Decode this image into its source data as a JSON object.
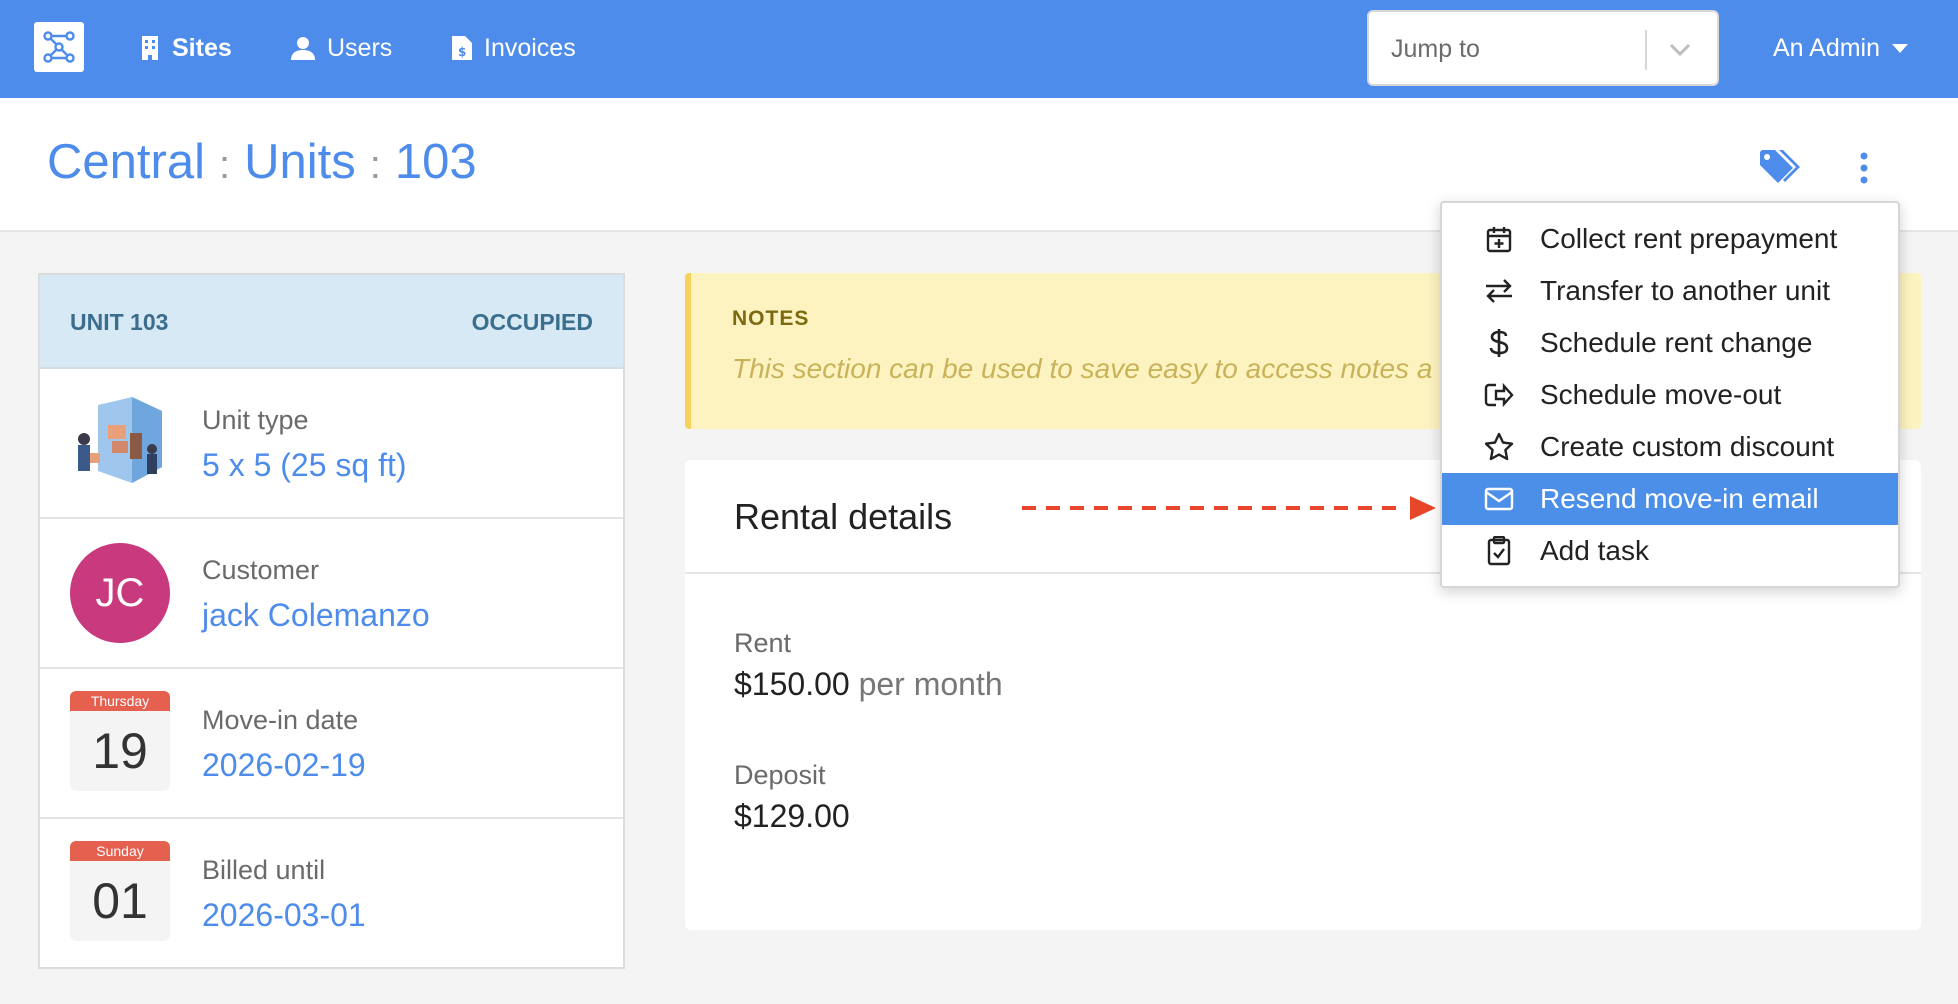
{
  "navbar": {
    "links": [
      {
        "label": "Sites",
        "icon": "building-icon",
        "active": true
      },
      {
        "label": "Users",
        "icon": "user-icon",
        "active": false
      },
      {
        "label": "Invoices",
        "icon": "invoice-icon",
        "active": false
      }
    ],
    "jump_to": {
      "placeholder": "Jump to"
    },
    "admin_label": "An Admin"
  },
  "breadcrumb": [
    "Central",
    "Units",
    "103"
  ],
  "unit_panel": {
    "header_left": "UNIT 103",
    "header_right": "OCCUPIED",
    "unit_type": {
      "label": "Unit type",
      "value": "5 x 5 (25 sq ft)"
    },
    "customer": {
      "label": "Customer",
      "value": "jack Colemanzo",
      "initials": "JC"
    },
    "move_in": {
      "label": "Move-in date",
      "value": "2026-02-19",
      "day_name": "Thursday",
      "day_num": "19"
    },
    "billed_until": {
      "label": "Billed until",
      "value": "2026-03-01",
      "day_name": "Sunday",
      "day_num": "01"
    }
  },
  "notes": {
    "title": "NOTES",
    "text": "This section can be used to save easy to access notes a"
  },
  "rental_details": {
    "title": "Rental details",
    "rent_label": "Rent",
    "rent_value": "$150.00",
    "rent_period": "per month",
    "deposit_label": "Deposit",
    "deposit_value": "$129.00"
  },
  "menu": {
    "items": [
      {
        "label": "Collect rent prepayment",
        "icon": "calendar-plus-icon"
      },
      {
        "label": "Transfer to another unit",
        "icon": "transfer-arrows-icon"
      },
      {
        "label": "Schedule rent change",
        "icon": "dollar-icon"
      },
      {
        "label": "Schedule move-out",
        "icon": "move-out-icon"
      },
      {
        "label": "Create custom discount",
        "icon": "star-icon"
      },
      {
        "label": "Resend move-in email",
        "icon": "envelope-icon",
        "highlighted": true
      },
      {
        "label": "Add task",
        "icon": "clipboard-check-icon"
      }
    ]
  },
  "colors": {
    "navbar": "#4e8ceb",
    "accent": "#4e8ceb",
    "avatar": "#c9397e",
    "menu_highlight": "#4c8fe8",
    "annotation_arrow": "#e8462a"
  }
}
